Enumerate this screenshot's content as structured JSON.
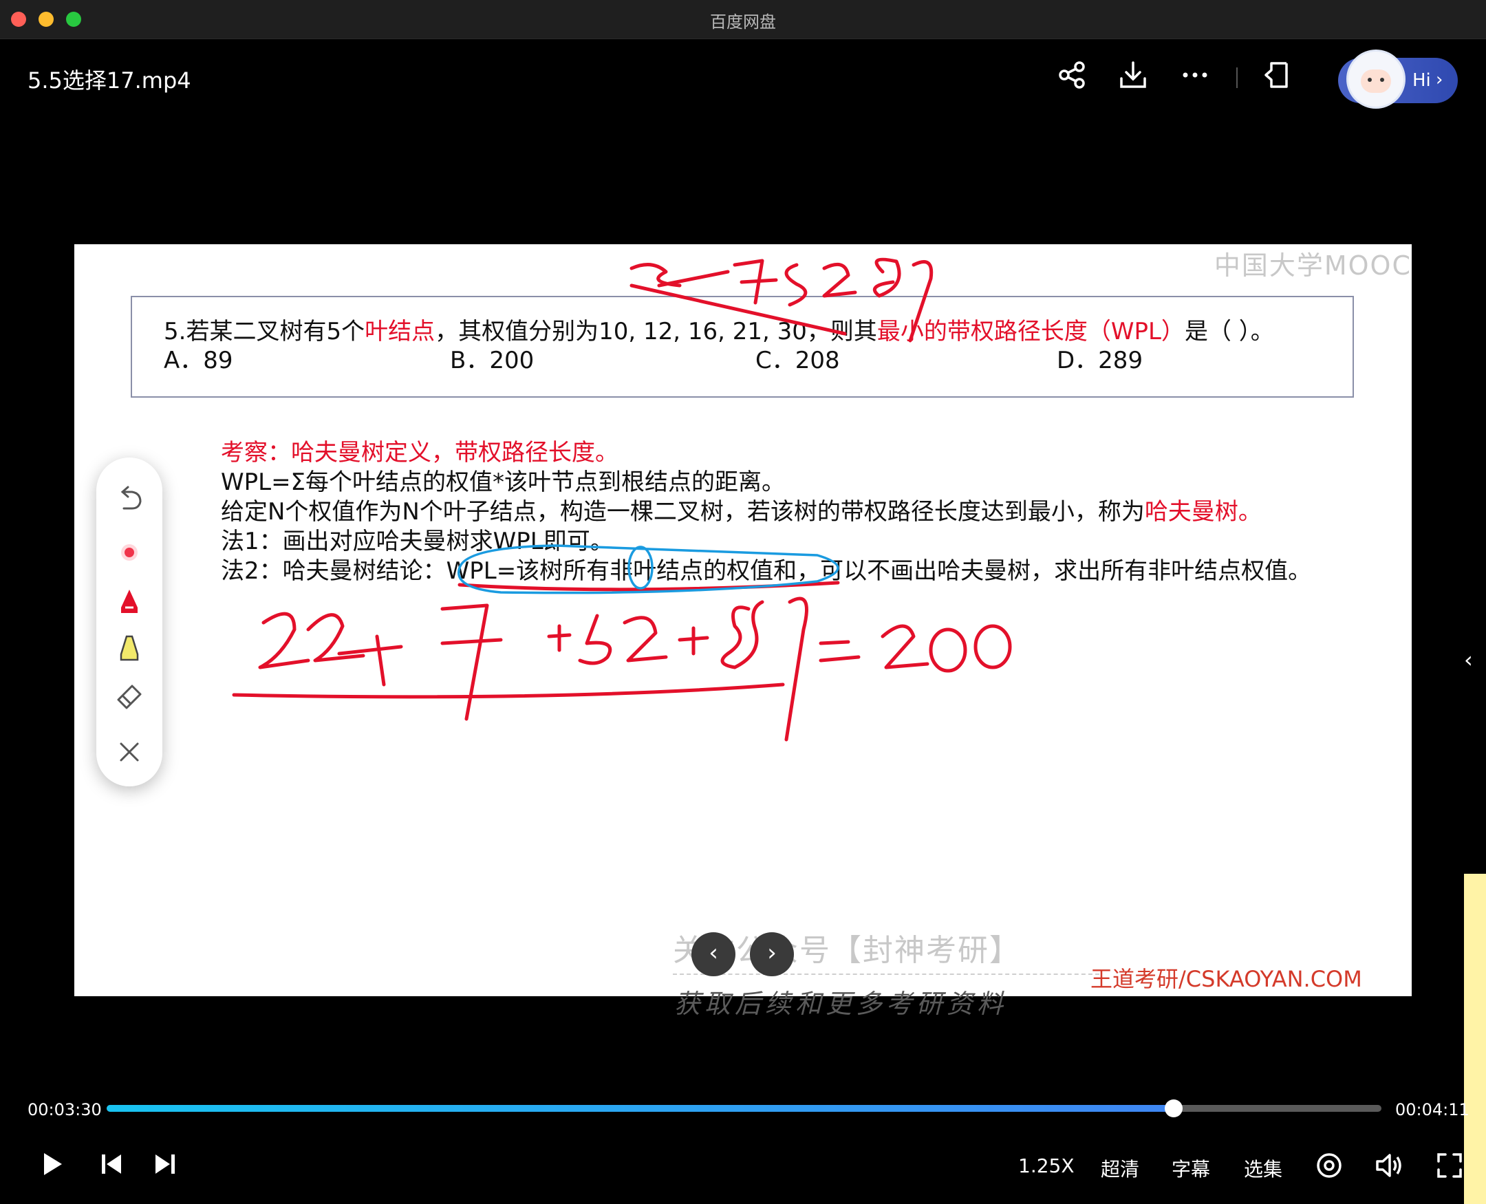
{
  "window": {
    "app_title": "百度网盘"
  },
  "header": {
    "file_title": "5.5选择17.mp4",
    "icons": [
      "share-icon",
      "download-icon",
      "more-icon",
      "picture-in-picture-icon"
    ],
    "assistant_label": "Hi"
  },
  "slide": {
    "mooc_logo": "中国大学MOOC",
    "question": {
      "prefix": "5.若某二叉树有5个",
      "red1": "叶结点",
      "mid": "，其权值分别为10, 12, 16, 21, 30，则其",
      "red2": "最小的带权路径长度（WPL）",
      "suffix": "是（   ）。",
      "options": [
        "A．89",
        "B．200",
        "C．208",
        "D．289"
      ]
    },
    "notes": {
      "line1": "考察：哈夫曼树定义，带权路径长度。",
      "line2": "WPL=Σ每个叶结点的权值*该叶节点到根结点的距离。",
      "line3_a": "给定N个权值作为N个叶子结点，构造一棵二叉树，若该树的带权路径长度达到最小，称为",
      "line3_red": "哈夫曼树。",
      "line4": "法1：画出对应哈夫曼树求WPL即可。",
      "line5": "法2：哈夫曼树结论：WPL=该树所有非叶结点的权值和，可以不画出哈夫曼树，求出所有非叶结点权值。"
    },
    "handwriting": {
      "top": "22+37+52+89",
      "bottom": "22+37+52+89=200"
    },
    "watermark_follow": "关注公众号【封神考研】",
    "watermark_site": "王道考研/CSKAOYAN.COM"
  },
  "overlay_watermark": "获取后续和更多考研资料",
  "pen_toolbar": [
    "undo-icon",
    "laser-pointer-icon",
    "red-pen-icon",
    "highlighter-icon",
    "eraser-icon",
    "close-icon"
  ],
  "player": {
    "current_time": "00:03:30",
    "duration": "00:04:11",
    "progress": 0.837,
    "speed": "1.25X",
    "quality": "超清",
    "subtitles": "字幕",
    "episodes": "选集",
    "colors": {
      "accent_start": "#19c3f0",
      "accent_end": "#3f86f2",
      "ink_red": "#e3102a",
      "ink_blue": "#1a9be0"
    }
  }
}
